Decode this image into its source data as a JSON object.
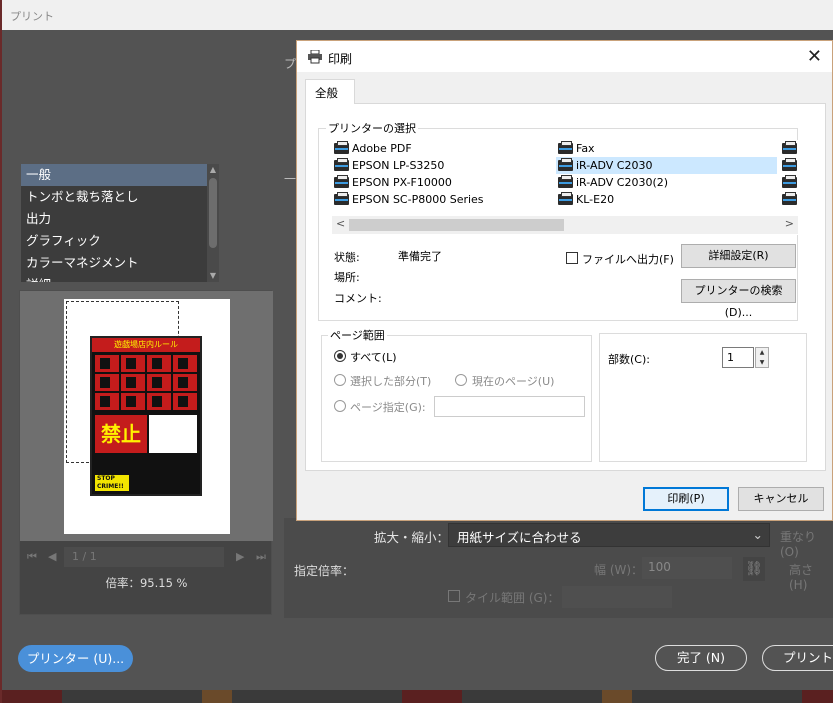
{
  "background": {
    "window_title": "プリント",
    "top_label": "プ",
    "side_label": "一般",
    "categories": [
      "一般",
      "トンボと裁ち落とし",
      "出力",
      "グラフィック",
      "カラーマネジメント",
      "詳細"
    ],
    "selected_category": 0,
    "page_nav": {
      "current": "1 / 1"
    },
    "zoom_text": "倍率：95.15 %",
    "poster": {
      "heading": "遊戯場店内ルール",
      "big_text": "禁止",
      "stop_text": "STOP CRIME!!"
    },
    "scale_label": "拡大・縮小：",
    "scale_value": "用紙サイズに合わせる",
    "overlap_label": "重なり (O)",
    "zoomrate_label": "指定倍率：",
    "width_label": "幅 (W)：",
    "width_value": "100",
    "height_label": "高さ (H)",
    "tile_label": "タイル範囲 (G)：",
    "printer_button": "プリンター (U)...",
    "done_button": "完了 (N)",
    "print_button": "プリント"
  },
  "dialog": {
    "title": "印刷",
    "tab": "全般",
    "printer_group_label": "プリンターの選択",
    "printers": [
      {
        "name": "Adobe PDF",
        "col": 0,
        "row": 0
      },
      {
        "name": "EPSON LP-S3250",
        "col": 0,
        "row": 1
      },
      {
        "name": "EPSON PX-F10000",
        "col": 0,
        "row": 2
      },
      {
        "name": "EPSON SC-P8000 Series",
        "col": 0,
        "row": 3
      },
      {
        "name": "Fax",
        "col": 1,
        "row": 0
      },
      {
        "name": "iR-ADV C2030",
        "col": 1,
        "row": 1,
        "selected": true
      },
      {
        "name": "iR-ADV C2030(2)",
        "col": 1,
        "row": 2
      },
      {
        "name": "KL-E20",
        "col": 1,
        "row": 3
      }
    ],
    "status_label": "状態:",
    "status_value": "準備完了",
    "location_label": "場所:",
    "comment_label": "コメント:",
    "print_to_file_label": "ファイルへ出力(F)",
    "preferences_button": "詳細設定(R)",
    "find_printer_button": "プリンターの検索(D)...",
    "page_range_label": "ページ範囲",
    "range_all": "すべて(L)",
    "range_selection": "選択した部分(T)",
    "range_current": "現在のページ(U)",
    "range_pages": "ページ指定(G):",
    "copies_label": "部数(C):",
    "copies_value": "1",
    "print_button": "印刷(P)",
    "cancel_button": "キャンセル"
  }
}
